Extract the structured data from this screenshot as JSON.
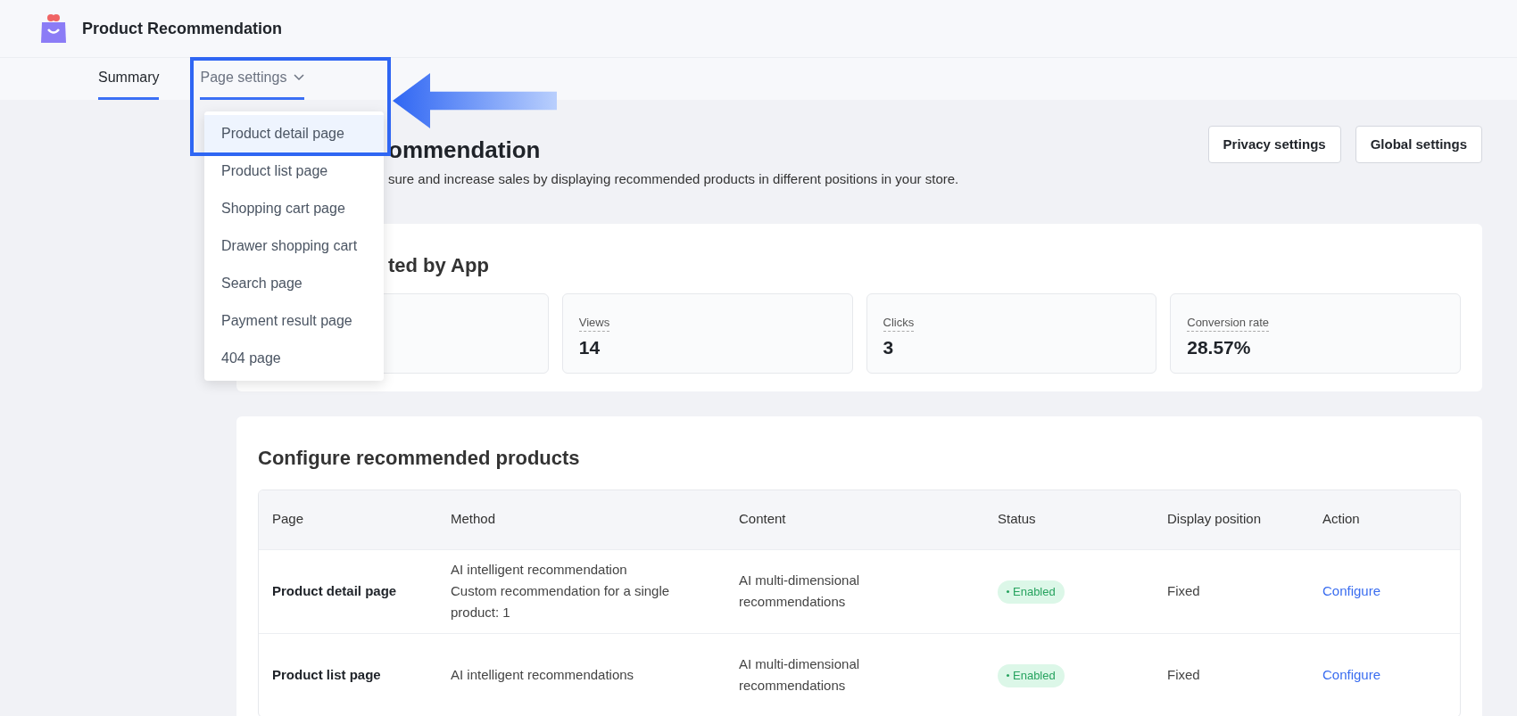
{
  "app": {
    "title": "Product Recommendation"
  },
  "tabs": [
    {
      "label": "Summary",
      "selected": true,
      "expanded": false
    },
    {
      "label": "Page settings",
      "selected": false,
      "expanded": true
    }
  ],
  "dropdown": {
    "items": [
      {
        "label": "Product detail page",
        "selected": true
      },
      {
        "label": "Product list page",
        "selected": false
      },
      {
        "label": "Shopping cart page",
        "selected": false
      },
      {
        "label": "Drawer shopping cart",
        "selected": false
      },
      {
        "label": "Search page",
        "selected": false
      },
      {
        "label": "Payment result page",
        "selected": false
      },
      {
        "label": "404 page",
        "selected": false
      }
    ]
  },
  "page": {
    "title": "ommendation",
    "description": "sure and increase sales by displaying recommended products in different positions in your store.",
    "buttons": [
      "Privacy settings",
      "Global settings"
    ]
  },
  "stats": {
    "title": "ted by App",
    "cards": [
      {
        "label": "Views",
        "value": "14"
      },
      {
        "label": "Clicks",
        "value": "3"
      },
      {
        "label": "Conversion rate",
        "value": "28.57%"
      }
    ]
  },
  "config": {
    "title": "Configure recommended products",
    "columns": [
      "Page",
      "Method",
      "Content",
      "Status",
      "Display position",
      "Action"
    ],
    "rows": [
      {
        "page": "Product detail page",
        "method": [
          "AI intelligent recommendation",
          "Custom recommendation for a single product: 1"
        ],
        "content": "AI multi-dimensional recommendations",
        "status": "Enabled",
        "enabled": true,
        "position": "Fixed",
        "action": "Configure"
      },
      {
        "page": "Product list page",
        "method": [
          "AI intelligent recommendations"
        ],
        "content": "AI multi-dimensional recommendations",
        "status": "Enabled",
        "enabled": true,
        "position": "Fixed",
        "action": "Configure"
      }
    ]
  }
}
